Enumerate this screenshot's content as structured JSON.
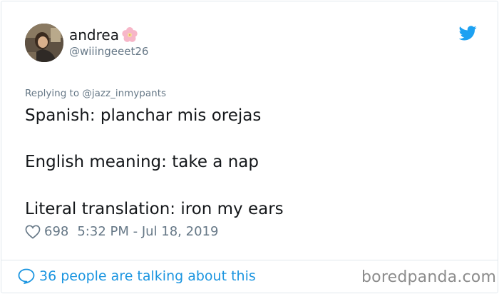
{
  "user": {
    "display_name": "andrea",
    "handle": "@wiiingeeet26"
  },
  "reply": {
    "label": "Replying to @jazz_inmypants"
  },
  "tweet": {
    "lines": [
      "Spanish: planchar mis orejas",
      "English meaning: take a nap",
      "Literal translation: iron my ears"
    ]
  },
  "meta": {
    "likes": "698",
    "timestamp": "5:32 PM - Jul 18, 2019"
  },
  "footer": {
    "conversation": "36 people are talking about this",
    "watermark": "boredpanda.com"
  },
  "colors": {
    "twitter_blue": "#1da1f2",
    "link_blue": "#1b95e0",
    "text": "#14171a",
    "muted": "#657786"
  },
  "icons": [
    "avatar-photo",
    "cherry-blossom-emoji",
    "twitter-bird-icon",
    "heart-icon",
    "speech-bubble-icon"
  ]
}
